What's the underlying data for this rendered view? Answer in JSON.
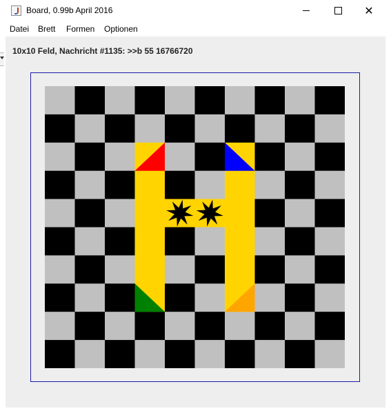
{
  "window": {
    "title": "Board, 0.99b April 2016",
    "controls": [
      "minimize",
      "maximize",
      "close"
    ],
    "close_glyph": "✕"
  },
  "menu": {
    "items": [
      "Datei",
      "Brett",
      "Formen",
      "Optionen"
    ]
  },
  "status": {
    "text": "10x10 Feld, Nachricht #1135: >>b 55 16766720"
  },
  "colors": {
    "light_square": "#c0c0c0",
    "dark_square": "#000000",
    "piece_yellow": "#ffd400",
    "red": "#ff0000",
    "blue": "#0000ff",
    "green": "#008000",
    "orange": "#ffa500",
    "frame": "#1a1aa6",
    "background": "#eeeeee"
  },
  "board": {
    "size": 10,
    "highlighted": [
      [
        2,
        3
      ],
      [
        2,
        6
      ],
      [
        3,
        3
      ],
      [
        3,
        6
      ],
      [
        4,
        3
      ],
      [
        4,
        4
      ],
      [
        4,
        5
      ],
      [
        4,
        6
      ],
      [
        5,
        3
      ],
      [
        5,
        6
      ],
      [
        6,
        3
      ],
      [
        6,
        6
      ],
      [
        7,
        3
      ],
      [
        7,
        6
      ]
    ],
    "triangles": [
      {
        "row": 2,
        "col": 3,
        "corner": "bottom-left",
        "color": "red"
      },
      {
        "row": 2,
        "col": 6,
        "corner": "top-left",
        "color": "blue"
      },
      {
        "row": 7,
        "col": 3,
        "corner": "top-left",
        "color": "green"
      },
      {
        "row": 7,
        "col": 6,
        "corner": "bottom-left",
        "color": "orange"
      }
    ],
    "stars": [
      {
        "row": 4,
        "col": 4,
        "icon": "star-burst-icon"
      },
      {
        "row": 4,
        "col": 5,
        "icon": "star-burst-icon"
      }
    ]
  }
}
